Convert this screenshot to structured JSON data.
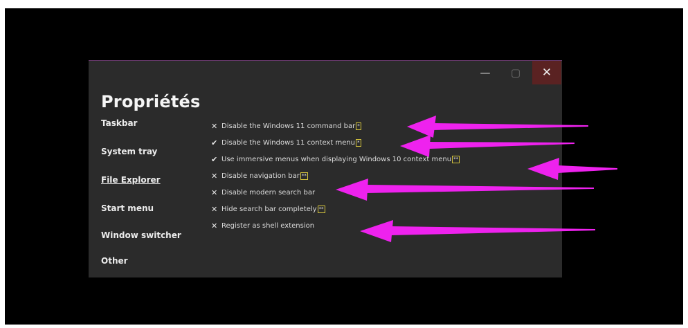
{
  "window": {
    "controls": {
      "minimize": "—",
      "maximize": "▢",
      "close": "✕"
    },
    "heading": "Propriétés"
  },
  "nav": {
    "items": [
      {
        "label": "Taskbar",
        "active": false
      },
      {
        "label": "System tray",
        "active": false
      },
      {
        "label": "File Explorer",
        "active": true
      },
      {
        "label": "Start menu",
        "active": false
      },
      {
        "label": "Window switcher",
        "active": false
      },
      {
        "label": "Other",
        "active": false
      }
    ]
  },
  "options": [
    {
      "mark": "✕",
      "label": "Disable the Windows 11 command bar",
      "badge": "*"
    },
    {
      "mark": "✔",
      "label": "Disable the Windows 11 context menu",
      "badge": "*"
    },
    {
      "mark": "✔",
      "label": "Use immersive menus when displaying Windows 10 context menu",
      "badge": "**"
    },
    {
      "mark": "✕",
      "label": "Disable navigation bar",
      "badge": "**"
    },
    {
      "mark": "✕",
      "label": "Disable modern search bar",
      "badge": ""
    },
    {
      "mark": "✕",
      "label": "Hide search bar completely",
      "badge": "**"
    },
    {
      "mark": "✕",
      "label": "Register as shell extension",
      "badge": ""
    }
  ],
  "annotation_color": "#ee22ee"
}
